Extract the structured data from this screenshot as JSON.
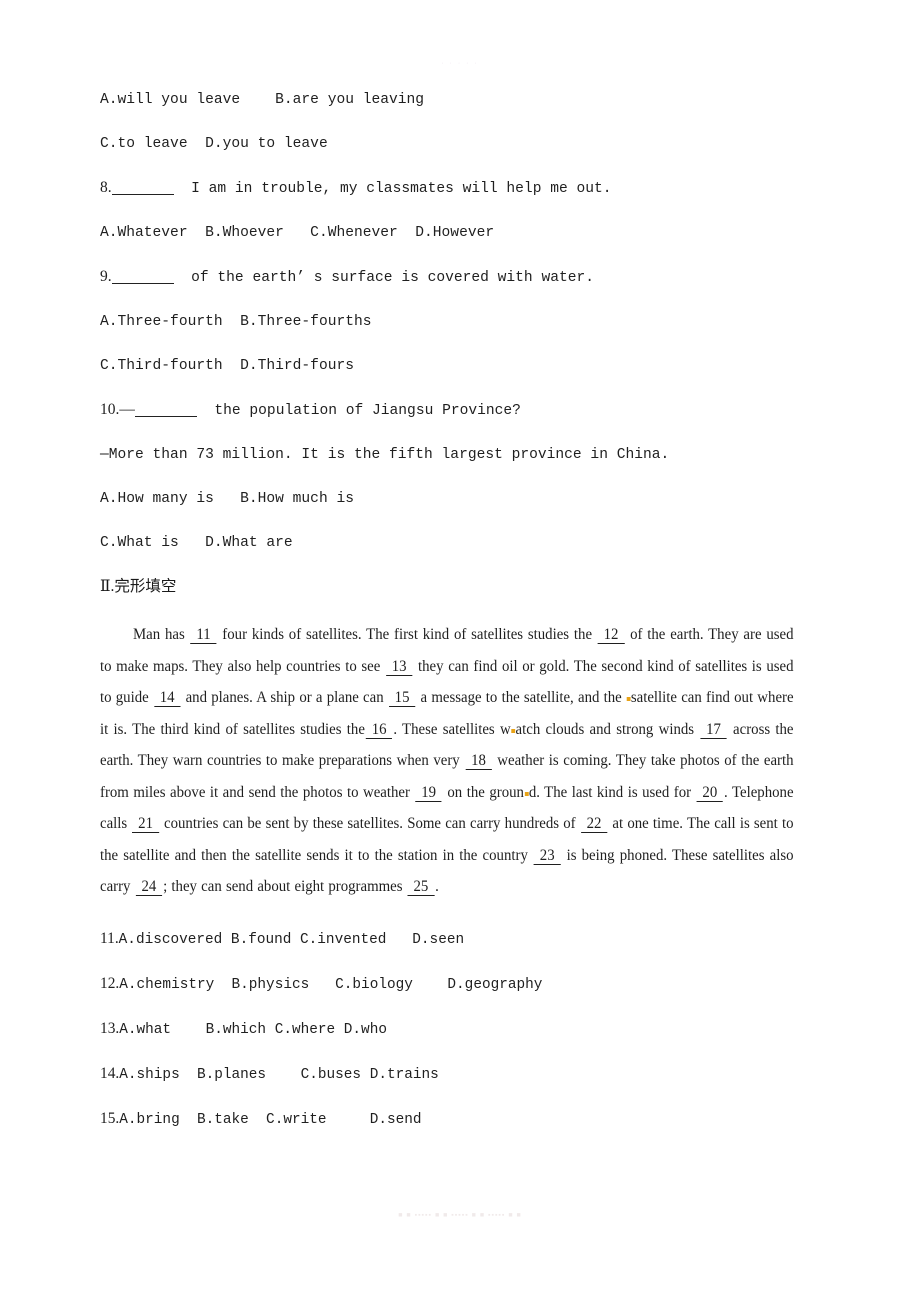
{
  "page": {
    "watermark_top": "· · · · ·",
    "watermark_bottom": "■ ■ ▪▪▪▪▪ ■ ■ ▪▪▪▪▪ ■ ■ ▪▪▪▪▪ ■ ■"
  },
  "mc_questions": [
    {
      "id": "q7-options-ab",
      "text": "A.will you leave    B.are you leaving"
    },
    {
      "id": "q7-options-cd",
      "text": "C.to leave  D.you to leave"
    }
  ],
  "question8": {
    "number": "8.",
    "blank": "",
    "stem": "  I am in trouble, my classmates will help me out.",
    "options": "A.Whatever  B.Whoever   C.Whenever  D.However"
  },
  "question9": {
    "number": "9.",
    "blank": "",
    "stem": "  of the earth’ s surface is covered with water.",
    "options_ab": "A.Three-fourth  B.Three-fourths",
    "options_cd": "C.Third-fourth  D.Third-fours"
  },
  "question10": {
    "number": "10.—",
    "blank": "",
    "stem": "  the population of Jiangsu Province?",
    "answer_line": "—More than 73 million. It is the fifth largest province in China.",
    "options_ab": "A.How many is   B.How much is",
    "options_cd": "C.What is   D.What are"
  },
  "section2": {
    "heading": "Ⅱ.完形填空"
  },
  "cloze_passage": {
    "segments": [
      {
        "type": "indent"
      },
      {
        "type": "text",
        "value": "Man has "
      },
      {
        "type": "gap",
        "value": "11"
      },
      {
        "type": "text",
        "value": " four kinds of satellites. The first kind of satellites studies the "
      },
      {
        "type": "gap",
        "value": "12"
      },
      {
        "type": "text",
        "value": " of the earth. They are used to make maps. They also help countries to see "
      },
      {
        "type": "gap",
        "value": "13"
      },
      {
        "type": "text",
        "value": " they can find oil or gold. The second kind of satellites is used to guide "
      },
      {
        "type": "gap",
        "value": "14"
      },
      {
        "type": "text",
        "value": " and planes. A ship or a plane can "
      },
      {
        "type": "gap",
        "value": "15"
      },
      {
        "type": "text",
        "value": " a message to the satellite, and the "
      },
      {
        "type": "dot"
      },
      {
        "type": "text",
        "value": "satellite can find out where it is. The third kind of satellites studies the"
      },
      {
        "type": "gap",
        "value": "16"
      },
      {
        "type": "text",
        "value": ". These satellites w"
      },
      {
        "type": "dot"
      },
      {
        "type": "text",
        "value": "atch clouds and strong winds "
      },
      {
        "type": "gap",
        "value": "17"
      },
      {
        "type": "text",
        "value": " across the earth. They warn countries to make preparations when very "
      },
      {
        "type": "gap",
        "value": "18"
      },
      {
        "type": "text",
        "value": " weather is coming. They take photos of the earth from miles above it and send the photos to weather "
      },
      {
        "type": "gap",
        "value": "19"
      },
      {
        "type": "text",
        "value": " on the groun"
      },
      {
        "type": "dot"
      },
      {
        "type": "text",
        "value": "d. The last kind is used for "
      },
      {
        "type": "gap",
        "value": "20"
      },
      {
        "type": "text",
        "value": ". Telephone calls "
      },
      {
        "type": "gap",
        "value": "21"
      },
      {
        "type": "text",
        "value": " countries can be sent by these satellites. Some can carry hundreds of "
      },
      {
        "type": "gap",
        "value": "22"
      },
      {
        "type": "text",
        "value": " at one time. The call is sent to the satellite and then the satellite sends it to the station in the country "
      },
      {
        "type": "gap",
        "value": "23"
      },
      {
        "type": "text",
        "value": " is being phoned. These satellites also carry "
      },
      {
        "type": "gap",
        "value": "24"
      },
      {
        "type": "text",
        "value": "; they can send about eight programmes "
      },
      {
        "type": "gap",
        "value": "25"
      },
      {
        "type": "text",
        "value": "."
      }
    ]
  },
  "cloze_options": [
    {
      "number": "11.",
      "text": "A.discovered B.found C.invented   D.seen"
    },
    {
      "number": "12.",
      "text": "A.chemistry  B.physics   C.biology    D.geography"
    },
    {
      "number": "13.",
      "text": "A.what    B.which C.where D.who"
    },
    {
      "number": "14.",
      "text": "A.ships  B.planes    C.buses D.trains"
    },
    {
      "number": "15.",
      "text": "A.bring  B.take  C.write     D.send"
    }
  ]
}
